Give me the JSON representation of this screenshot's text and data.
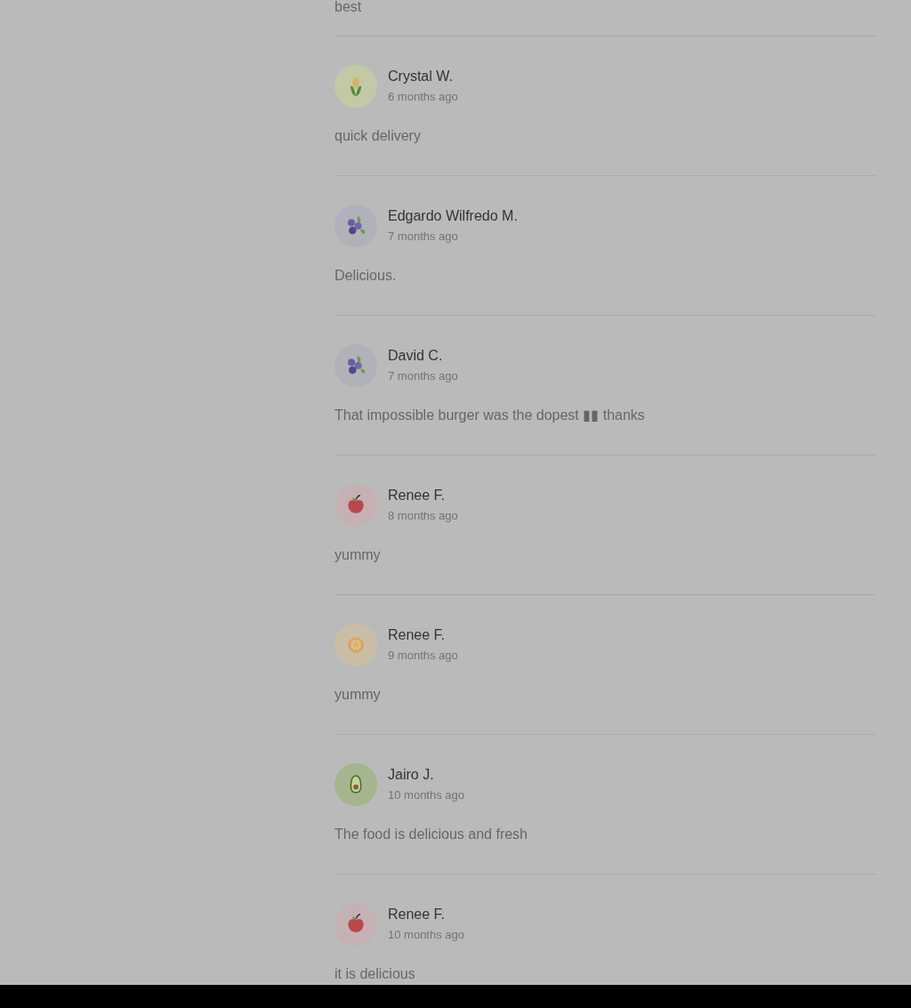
{
  "partial_review": {
    "text": "best"
  },
  "reviews": [
    {
      "name": "Crystal W.",
      "time": "6 months ago",
      "text": "quick delivery",
      "avatar": {
        "kind": "corn"
      }
    },
    {
      "name": "Edgardo Wilfredo M.",
      "time": "7 months ago",
      "text": "Delicious.",
      "avatar": {
        "kind": "blueberry"
      }
    },
    {
      "name": "David C.",
      "time": "7 months ago",
      "text": "That impossible burger was the dopest ▮▮ thanks",
      "avatar": {
        "kind": "blueberry"
      }
    },
    {
      "name": "Renee F.",
      "time": "8 months ago",
      "text": "yummy",
      "avatar": {
        "kind": "apple"
      }
    },
    {
      "name": "Renee F.",
      "time": "9 months ago",
      "text": "yummy",
      "avatar": {
        "kind": "citrus"
      }
    },
    {
      "name": "Jairo J.",
      "time": "10 months ago",
      "text": "The food is delicious and fresh",
      "avatar": {
        "kind": "avocado"
      }
    },
    {
      "name": "Renee F.",
      "time": "10 months ago",
      "text": "it is delicious",
      "avatar": {
        "kind": "apple"
      }
    }
  ]
}
